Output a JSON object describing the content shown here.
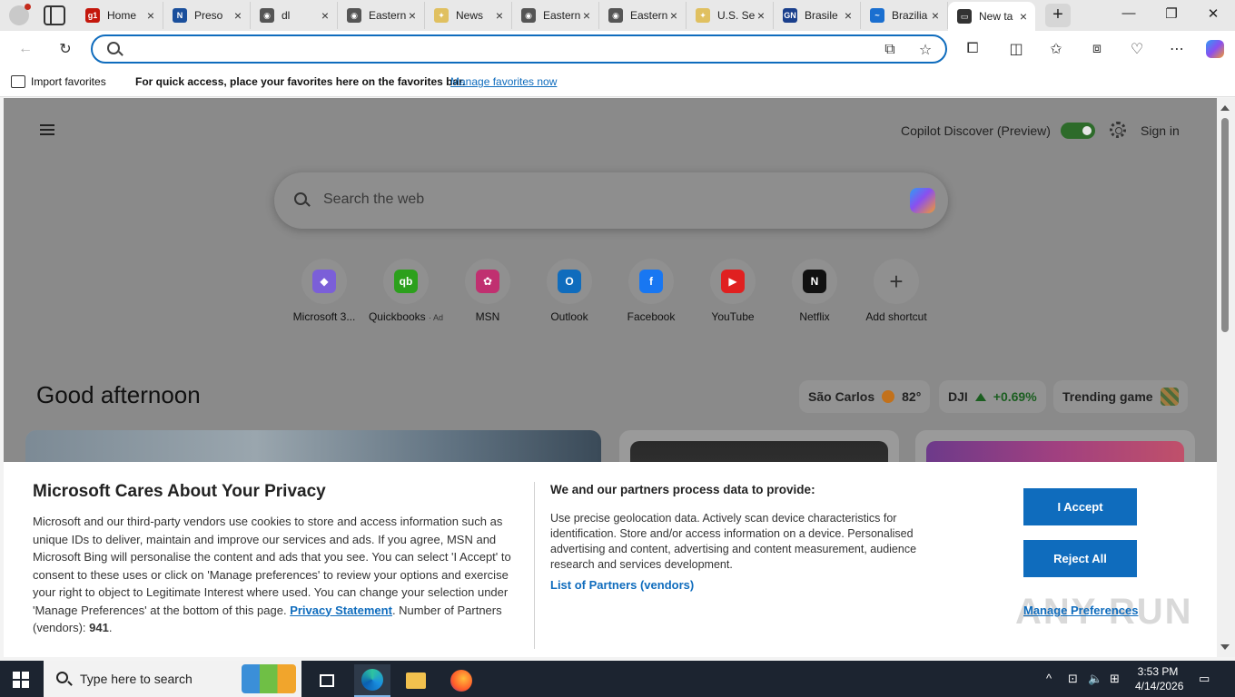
{
  "browser": {
    "tabs": [
      {
        "title": "Home",
        "icon": "g1-icon",
        "color": "#c4170c",
        "glyph": "g1"
      },
      {
        "title": "Preso",
        "icon": "news-icon",
        "color": "#1a4f9c",
        "glyph": "N"
      },
      {
        "title": "dl",
        "icon": "globe-icon",
        "color": "#555555",
        "glyph": "◉"
      },
      {
        "title": "Eastern",
        "icon": "globe-icon",
        "color": "#555555",
        "glyph": "◉"
      },
      {
        "title": "News",
        "icon": "star-icon",
        "color": "#e0c060",
        "glyph": "✦"
      },
      {
        "title": "Eastern",
        "icon": "globe-icon",
        "color": "#555555",
        "glyph": "◉"
      },
      {
        "title": "Eastern",
        "icon": "globe-icon",
        "color": "#555555",
        "glyph": "◉"
      },
      {
        "title": "U.S. Se",
        "icon": "star-icon",
        "color": "#e0c060",
        "glyph": "✦"
      },
      {
        "title": "Brasile",
        "icon": "gn-icon",
        "color": "#1a3f8c",
        "glyph": "GN"
      },
      {
        "title": "Brazilia",
        "icon": "wave-icon",
        "color": "#1a6fd0",
        "glyph": "~"
      },
      {
        "title": "New ta",
        "icon": "newtab-icon",
        "color": "#333333",
        "glyph": "▭",
        "active": true
      }
    ],
    "address": {
      "value": "",
      "placeholder": ""
    },
    "favorites_bar": {
      "import_label": "Import favorites",
      "message": "For quick access, place your favorites here on the favorites bar.",
      "manage_link": "Manage favorites now"
    }
  },
  "newtab": {
    "copilot_label": "Copilot Discover (Preview)",
    "sign_in": "Sign in",
    "search_placeholder": "Search the web",
    "shortcuts": [
      {
        "label": "Microsoft 3...",
        "icon": "microsoft365-icon",
        "color": "#7b5fd8",
        "glyph": "◆"
      },
      {
        "label": "Quickbooks",
        "ad": "· Ad",
        "icon": "quickbooks-icon",
        "color": "#2ca01c",
        "glyph": "qb"
      },
      {
        "label": "MSN",
        "icon": "msn-icon",
        "color": "#c03070",
        "glyph": "✿"
      },
      {
        "label": "Outlook",
        "icon": "outlook-icon",
        "color": "#0f6cbd",
        "glyph": "O"
      },
      {
        "label": "Facebook",
        "icon": "facebook-icon",
        "color": "#1877f2",
        "glyph": "f"
      },
      {
        "label": "YouTube",
        "icon": "youtube-icon",
        "color": "#e02020",
        "glyph": "▶"
      },
      {
        "label": "Netflix",
        "icon": "netflix-icon",
        "color": "#111111",
        "glyph": "N"
      },
      {
        "label": "Add shortcut",
        "icon": "plus-icon",
        "color": "transparent",
        "glyph": "+"
      }
    ],
    "greeting": "Good afternoon",
    "weather": {
      "city": "São Carlos",
      "temp": "82°"
    },
    "stock": {
      "symbol": "DJI",
      "change": "+0.69%"
    },
    "trending": "Trending game"
  },
  "privacy": {
    "title": "Microsoft Cares About Your Privacy",
    "body": "Microsoft and our third-party vendors use cookies to store and access information such as unique IDs to deliver, maintain and improve our services and ads. If you agree, MSN and Microsoft Bing will personalise the content and ads that you see. You can select 'I Accept' to consent to these uses or click on 'Manage preferences' to review your options and exercise your right to object to Legitimate Interest where used.  You can change your selection under 'Manage Preferences' at the bottom of this page.",
    "privacy_link": "Privacy Statement",
    "partners_count_label": "Number of Partners (vendors):",
    "partners_count": "941",
    "purposes_title": "We and our partners process data to provide:",
    "purposes": "Use precise geolocation data. Actively scan device characteristics for identification. Store and/or access information on a device. Personalised advertising and content, advertising and content measurement, audience research and services development.",
    "partners_link": "List of Partners (vendors)",
    "accept": "I Accept",
    "reject": "Reject All",
    "manage": "Manage Preferences",
    "watermark": "ANY RUN"
  },
  "taskbar": {
    "search_placeholder": "Type here to search",
    "time": "3:53 PM",
    "date": "4/14/2026"
  },
  "colors": {
    "accent": "#0f6cbd",
    "toggle_on": "#2d6b2a",
    "stock_up": "#1b5e20"
  }
}
